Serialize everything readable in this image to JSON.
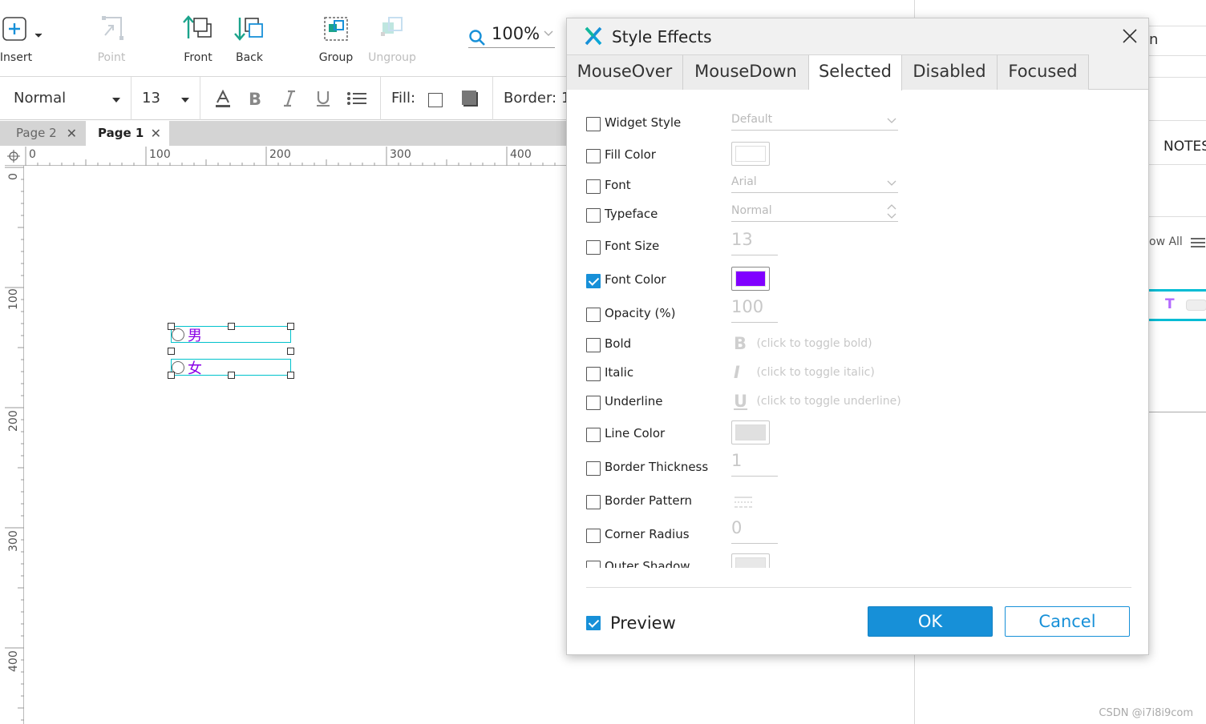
{
  "toolbar": {
    "insert_label": "Insert",
    "point_label": "Point",
    "front_label": "Front",
    "back_label": "Back",
    "group_label": "Group",
    "ungroup_label": "Ungroup",
    "zoom_value": "100%"
  },
  "format": {
    "style_value": "Normal",
    "size_value": "13",
    "fill_label": "Fill:",
    "border_label": "Border:",
    "border_value_partial": "1"
  },
  "pages": {
    "tabs": [
      {
        "label": "Page 2",
        "active": false
      },
      {
        "label": "Page 1",
        "active": true
      }
    ]
  },
  "rulers": {
    "h": [
      "0",
      "100",
      "200",
      "300",
      "400"
    ],
    "v": [
      "0",
      "100",
      "200",
      "300",
      "400"
    ]
  },
  "canvas": {
    "options": [
      "男",
      "女"
    ],
    "text_color": "#8a00e6"
  },
  "right_panel": {
    "notes_partial": "NOTES",
    "show_all_partial": "ow All",
    "top_partial": "n",
    "t_icon": "T"
  },
  "dialog": {
    "title": "Style Effects",
    "tabs": [
      "MouseOver",
      "MouseDown",
      "Selected",
      "Disabled",
      "Focused"
    ],
    "active_tab": "Selected",
    "properties": [
      {
        "label": "Widget Style",
        "checked": false,
        "control": "select",
        "value": "Default"
      },
      {
        "label": "Fill Color",
        "checked": false,
        "control": "swatch",
        "color": "#ffffff"
      },
      {
        "label": "Font",
        "checked": false,
        "control": "select",
        "value": "Arial"
      },
      {
        "label": "Typeface",
        "checked": false,
        "control": "select",
        "value": "Normal"
      },
      {
        "label": "Font Size",
        "checked": false,
        "control": "number",
        "value": "13"
      },
      {
        "label": "Font Color",
        "checked": true,
        "control": "swatch",
        "color": "#8000ff"
      },
      {
        "label": "Opacity (%)",
        "checked": false,
        "control": "number",
        "value": "100"
      },
      {
        "label": "Bold",
        "checked": false,
        "control": "toggle",
        "glyph": "B",
        "value": "(click to toggle bold)"
      },
      {
        "label": "Italic",
        "checked": false,
        "control": "toggle",
        "glyph": "I",
        "value": "(click to toggle italic)"
      },
      {
        "label": "Underline",
        "checked": false,
        "control": "toggle",
        "glyph": "U",
        "value": "(click to toggle underline)"
      },
      {
        "label": "Line Color",
        "checked": false,
        "control": "swatch",
        "color": "#e0e0e0"
      },
      {
        "label": "Border Thickness",
        "checked": false,
        "control": "number",
        "value": "1"
      },
      {
        "label": "Border Pattern",
        "checked": false,
        "control": "pattern"
      },
      {
        "label": "Corner Radius",
        "checked": false,
        "control": "number",
        "value": "0"
      },
      {
        "label": "Outer Shadow",
        "checked": false,
        "control": "swatch",
        "color": "#e8e8e8"
      }
    ],
    "preview_label": "Preview",
    "preview_checked": true,
    "ok_label": "OK",
    "cancel_label": "Cancel",
    "accent": "#1790d8"
  },
  "watermark": "CSDN @i7i8i9com"
}
